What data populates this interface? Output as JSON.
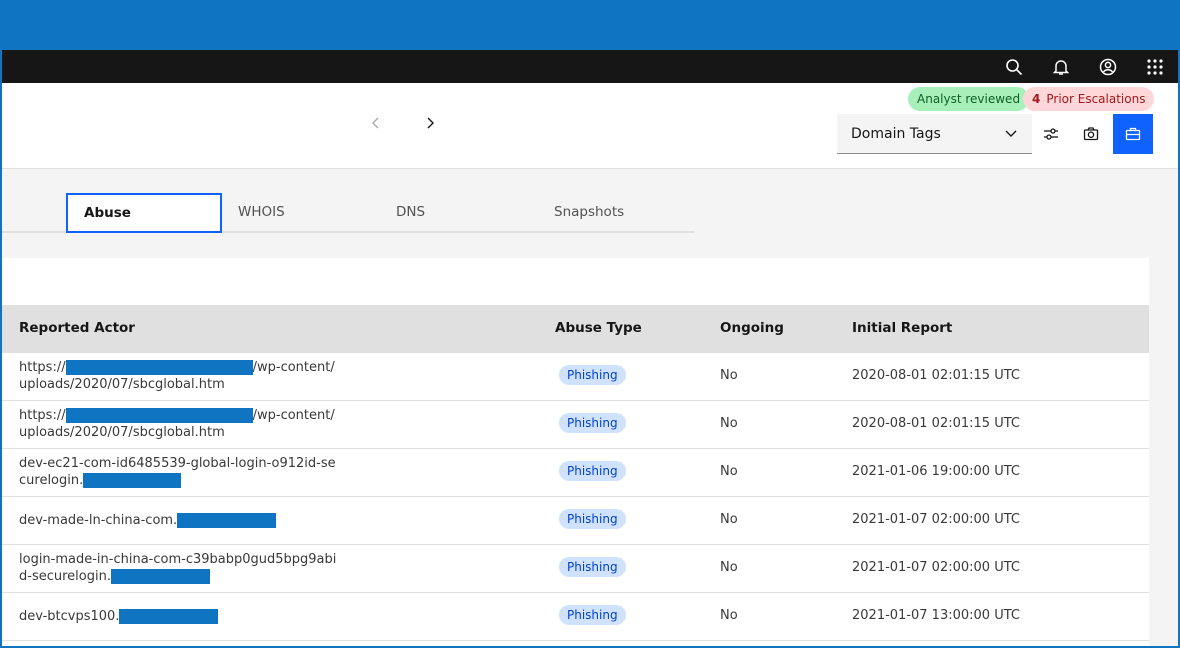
{
  "header": {
    "badges": {
      "analyst": "Analyst reviewed",
      "escalation_count": "4",
      "escalation_label": "Prior Escalations"
    },
    "dropdown_label": "Domain Tags"
  },
  "tabs": [
    "Abuse",
    "WHOIS",
    "DNS",
    "Snapshots"
  ],
  "table": {
    "columns": [
      "Reported Actor",
      "Abuse Type",
      "Ongoing",
      "Initial Report"
    ],
    "rows": [
      {
        "actor_prefix": "https://",
        "actor_suffix": "/wp-content/uploads/2020/07/sbcglobal.htm",
        "type": "Phishing",
        "ongoing": "No",
        "initial": "2020-08-01 02:01:15 UTC"
      },
      {
        "actor_prefix": "https://",
        "actor_suffix": "/wp-content/uploads/2020/07/sbcglobal.htm",
        "type": "Phishing",
        "ongoing": "No",
        "initial": "2020-08-01 02:01:15 UTC"
      },
      {
        "actor_prefix": "dev-ec21-com-id6485539-global-login-o912id-securelogin.",
        "actor_suffix": "",
        "type": "Phishing",
        "ongoing": "No",
        "initial": "2021-01-06 19:00:00 UTC"
      },
      {
        "actor_prefix": "dev-made-ln-china-com.",
        "actor_suffix": "",
        "type": "Phishing",
        "ongoing": "No",
        "initial": "2021-01-07 02:00:00 UTC"
      },
      {
        "actor_prefix": "login-made-in-china-com-c39babp0gud5bpg9abid-securelogin.",
        "actor_suffix": "",
        "type": "Phishing",
        "ongoing": "No",
        "initial": "2021-01-07 02:00:00 UTC"
      },
      {
        "actor_prefix": "dev-btcvps100.",
        "actor_suffix": "",
        "type": "Phishing",
        "ongoing": "No",
        "initial": "2021-01-07 13:00:00 UTC"
      }
    ]
  },
  "colors": {
    "accent": "#0f62fe",
    "redaction": "#0f75c2",
    "top_bar": "#161616"
  }
}
